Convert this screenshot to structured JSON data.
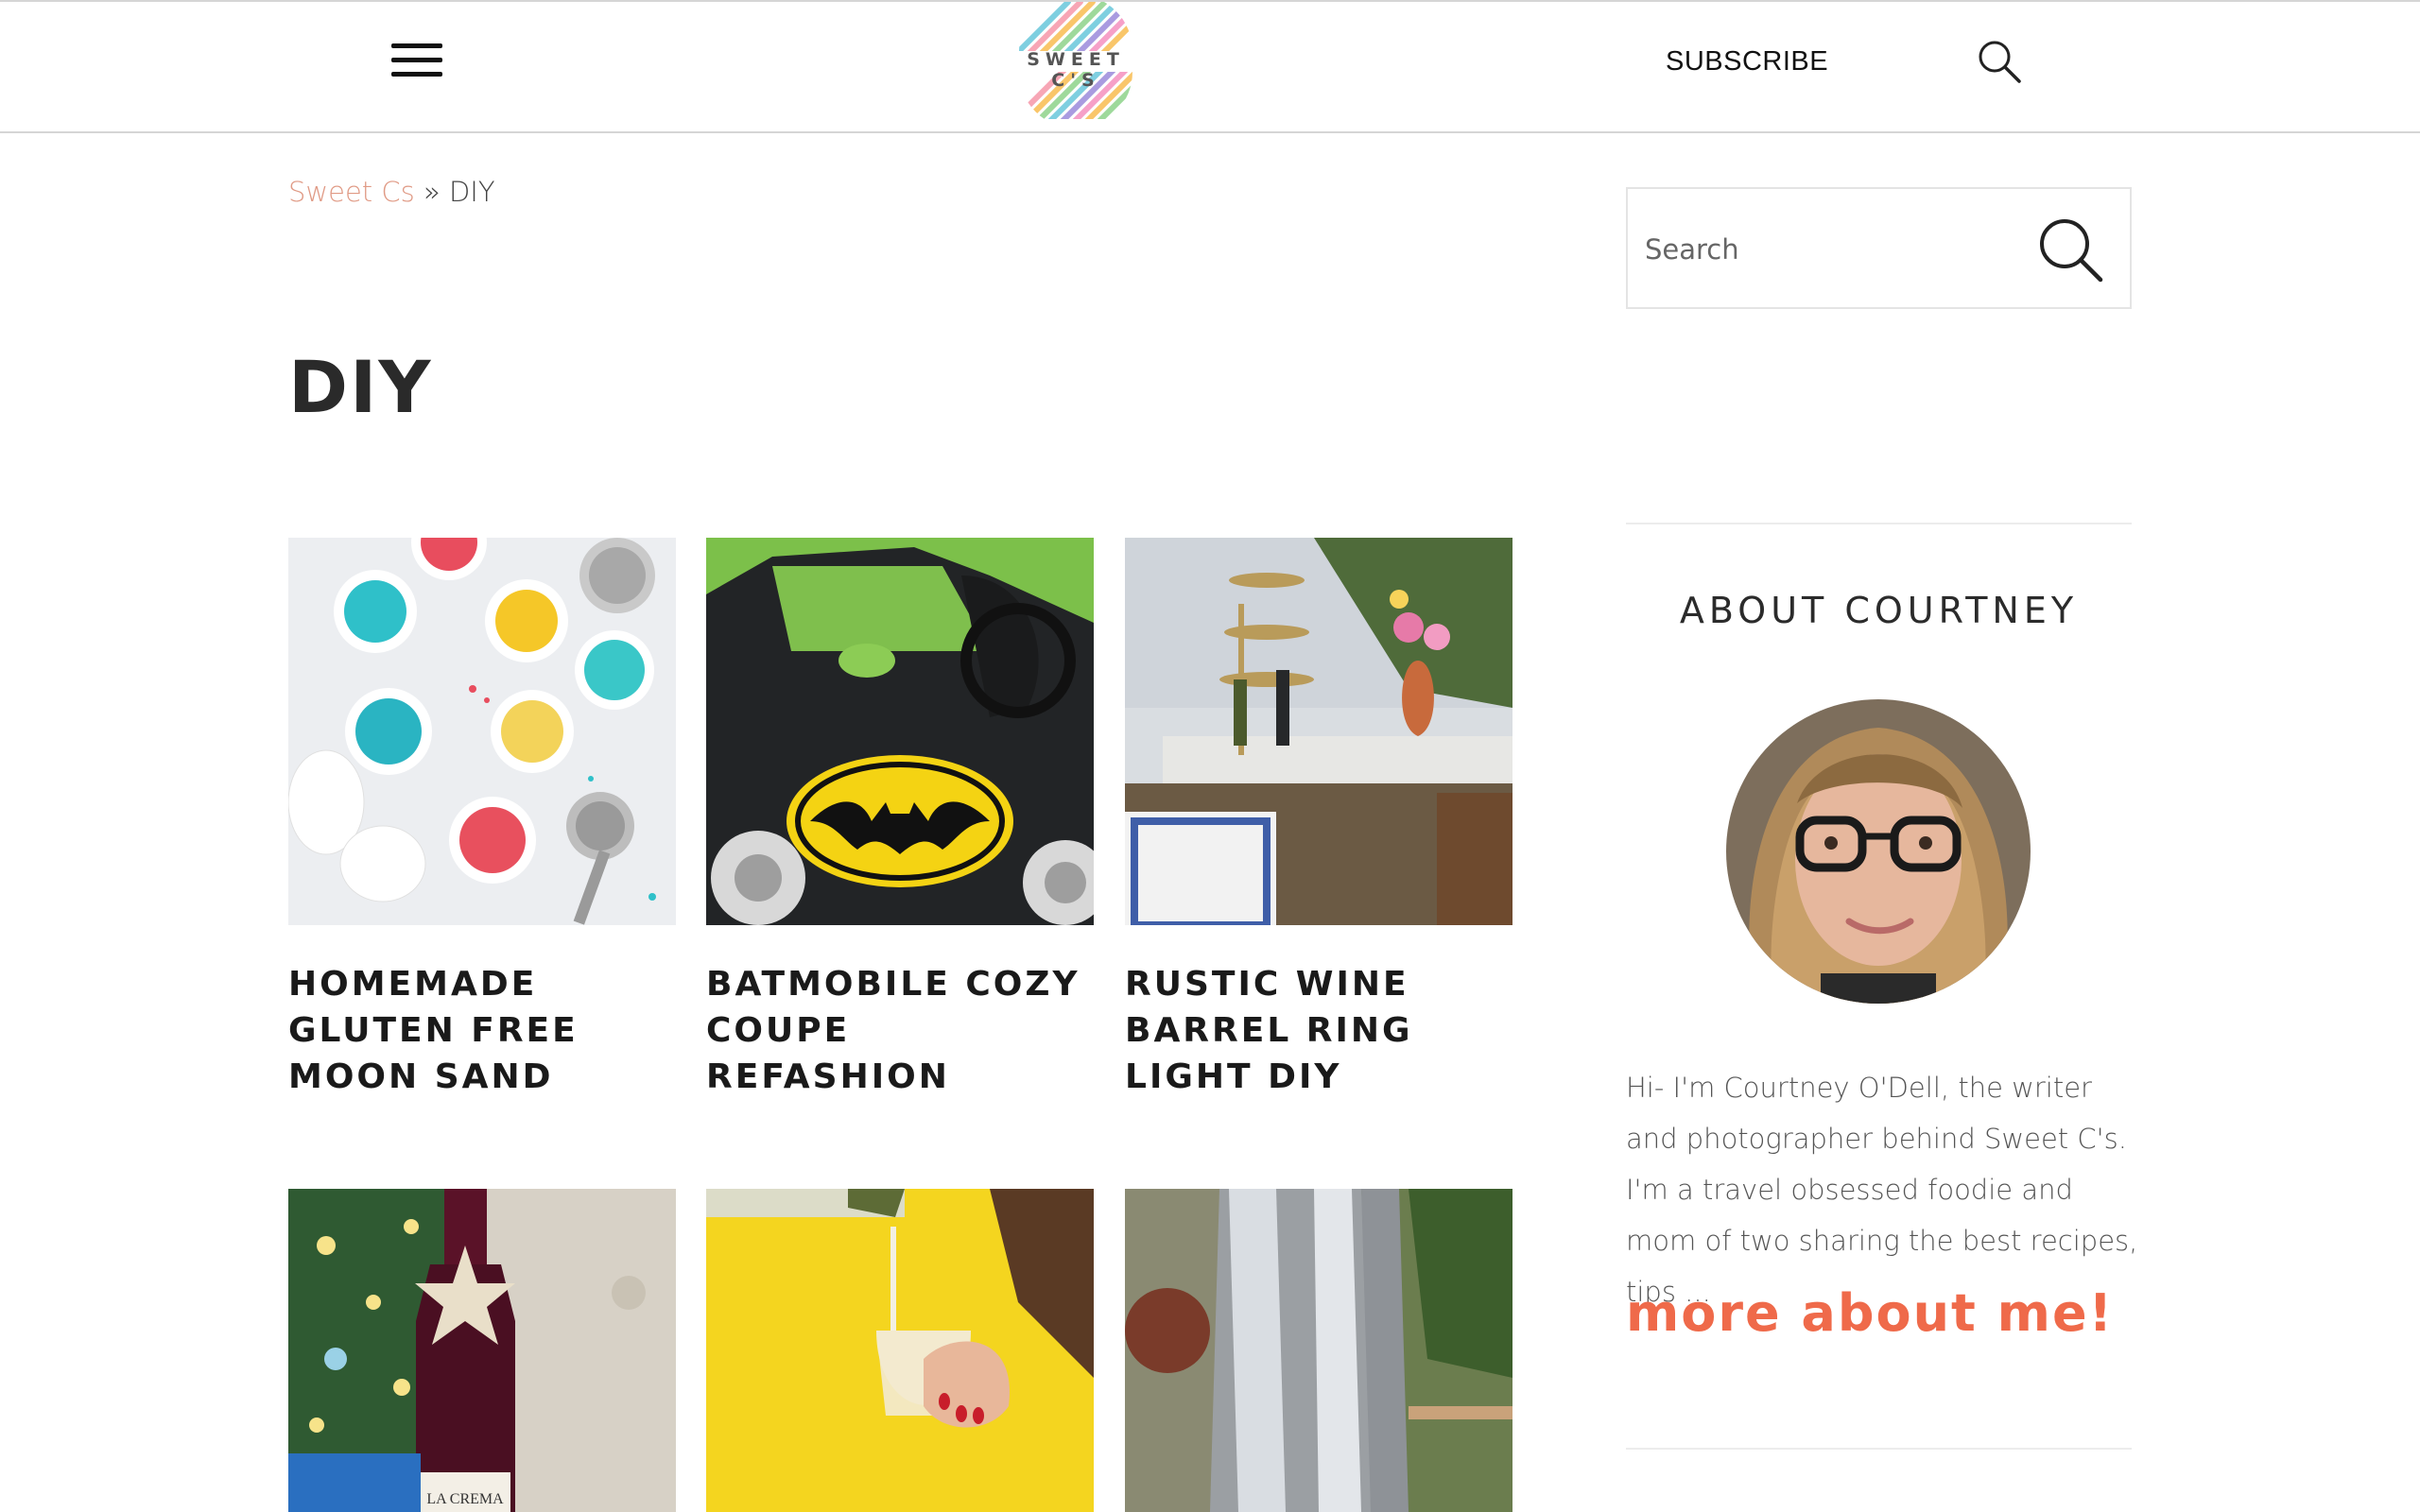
{
  "header": {
    "logo_text": "SWEET C'S",
    "subscribe_label": "SUBSCRIBE",
    "menu_icon": "hamburger-menu-icon",
    "search_icon": "search-icon"
  },
  "breadcrumb": {
    "home": "Sweet Cs",
    "separator": "»",
    "current": "DIY"
  },
  "page": {
    "title": "DIY"
  },
  "posts": [
    {
      "title": "HOMEMADE GLUTEN FREE MOON SAND"
    },
    {
      "title": "BATMOBILE COZY COUPE REFASHION"
    },
    {
      "title": "RUSTIC WINE BARREL RING LIGHT DIY"
    },
    {
      "title": ""
    },
    {
      "title": ""
    },
    {
      "title": ""
    }
  ],
  "sidebar": {
    "search_placeholder": "Search",
    "about_title": "ABOUT COURTNEY",
    "about_text": "Hi- I'm Courtney O'Dell, the writer and photographer behind Sweet C's. I'm a travel obsessed foodie and mom of two sharing the best recipes, tips ...",
    "more_link": "more about me!"
  },
  "colors": {
    "accent": "#ef6a4a",
    "breadcrumb_link": "#e09a85",
    "text_dark": "#1a1a1a"
  }
}
